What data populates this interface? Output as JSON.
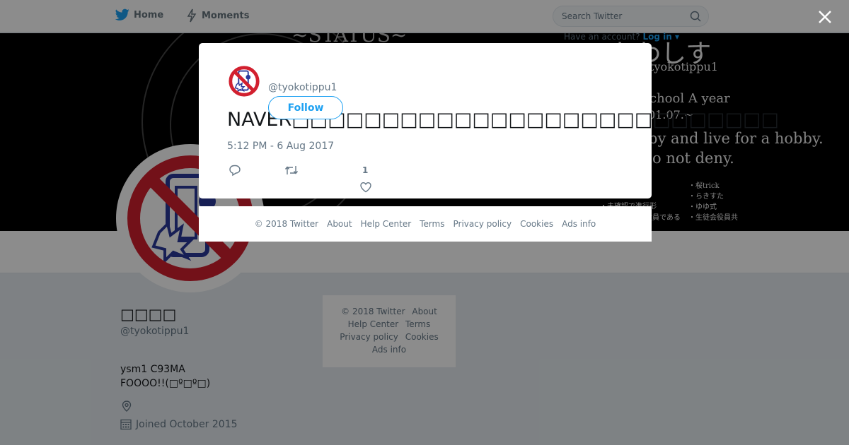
{
  "nav": {
    "home_label": "Home",
    "moments_label": "Moments",
    "search_placeholder": "Search Twitter",
    "have_account": "Have an account?",
    "login_label": "Log in"
  },
  "banner": {
    "title": "~STATUS~",
    "name": "たわしす",
    "handle": "@tyokotippu1",
    "lines": [
      "chool A year",
      "01.07.~",
      "by and live for a hobby.",
      "o not deny."
    ],
    "left_notes": [
      "・未確認で進行形",
      "・生徒会役員である"
    ],
    "right_notes": [
      "・桜trick",
      "・らきすた",
      "・ゆゆ式",
      "・生徒会役員共"
    ]
  },
  "profile": {
    "name": "□□□□",
    "handle": "@tyokotippu1",
    "bio_line1": "ysm1 C93MA",
    "bio_line2": "FOOOO!!(□º□º□)",
    "joined": "Joined October 2015"
  },
  "side_footer": {
    "copyright": "© 2018 Twitter",
    "about": "About",
    "help": "Help Center",
    "terms": "Terms",
    "privacy": "Privacy policy",
    "cookies": "Cookies",
    "ads": "Ads info"
  },
  "tweet": {
    "handle": "@tyokotippu1",
    "follow_label": "Follow",
    "text": "NAVER□□□□□□□□□□□□□□□□□□□□□□□□□□□",
    "time": "5:12 PM - 6 Aug 2017",
    "like_count": "1"
  },
  "modal_footer": {
    "copyright": "© 2018 Twitter",
    "about": "About",
    "help": "Help Center",
    "terms": "Terms",
    "privacy": "Privacy policy",
    "cookies": "Cookies",
    "ads": "Ads info"
  },
  "colors": {
    "accent": "#1da1f2",
    "overlay": "rgba(0,0,0,0.45)",
    "banner": "#000000",
    "background": "#e6ecf0"
  },
  "icons": [
    "twitter-bird-icon",
    "lightning-icon",
    "search-icon",
    "close-icon",
    "location-icon",
    "calendar-icon",
    "reply-icon",
    "retweet-icon",
    "heart-icon"
  ]
}
